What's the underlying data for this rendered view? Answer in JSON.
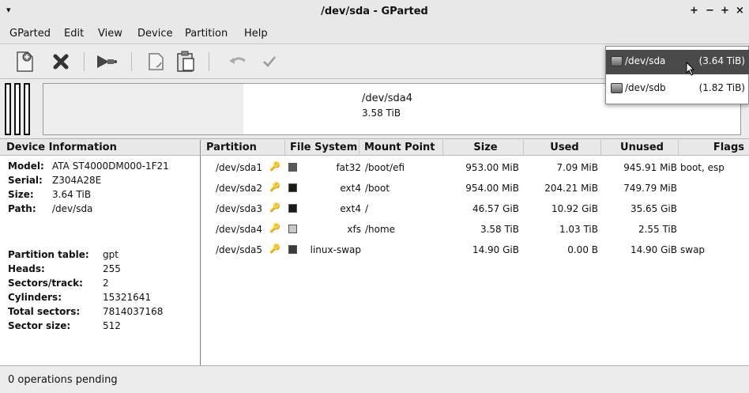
{
  "window": {
    "title": "/dev/sda - GParted",
    "menu_arrow": "▾",
    "controls": [
      "+",
      "−",
      "+",
      "×"
    ]
  },
  "menubar": [
    "GParted",
    "Edit",
    "View",
    "Device",
    "Partition",
    "Help"
  ],
  "toolbar": {
    "icons": [
      "new-partition",
      "delete",
      "resize-move",
      "copy",
      "paste",
      "undo",
      "apply"
    ]
  },
  "device_menu": {
    "items": [
      {
        "name": "/dev/sda",
        "size": "(3.64 TiB)",
        "selected": true
      },
      {
        "name": "/dev/sdb",
        "size": "(1.82 TiB)",
        "selected": false
      }
    ]
  },
  "disk_map": {
    "label": "/dev/sda4",
    "size": "3.58 TiB"
  },
  "device_info": {
    "header": "Device Information",
    "fields": [
      {
        "label": "Model:",
        "value": "ATA ST4000DM000-1F21"
      },
      {
        "label": "Serial:",
        "value": "Z304A28E"
      },
      {
        "label": "Size:",
        "value": "3.64 TiB"
      },
      {
        "label": "Path:",
        "value": "/dev/sda"
      }
    ],
    "table_fields": [
      {
        "label": "Partition table:",
        "value": "gpt"
      },
      {
        "label": "Heads:",
        "value": "255"
      },
      {
        "label": "Sectors/track:",
        "value": "2"
      },
      {
        "label": "Cylinders:",
        "value": "15321641"
      },
      {
        "label": "Total sectors:",
        "value": "7814037168"
      },
      {
        "label": "Sector size:",
        "value": "512"
      }
    ]
  },
  "partitions": {
    "columns": [
      "Partition",
      "File System",
      "Mount Point",
      "Size",
      "Used",
      "Unused",
      "Flags"
    ],
    "rows": [
      {
        "partition": "/dev/sda1",
        "color": "#5a5a5a",
        "fs": "fat32",
        "mount": "/boot/efi",
        "size": "953.00 MiB",
        "used": "7.09 MiB",
        "unused": "945.91 MiB",
        "flags": "boot, esp"
      },
      {
        "partition": "/dev/sda2",
        "color": "#1a1a1a",
        "fs": "ext4",
        "mount": "/boot",
        "size": "954.00 MiB",
        "used": "204.21 MiB",
        "unused": "749.79 MiB",
        "flags": ""
      },
      {
        "partition": "/dev/sda3",
        "color": "#1a1a1a",
        "fs": "ext4",
        "mount": "/",
        "size": "46.57 GiB",
        "used": "10.92 GiB",
        "unused": "35.65 GiB",
        "flags": ""
      },
      {
        "partition": "/dev/sda4",
        "color": "#c8c8c8",
        "fs": "xfs",
        "mount": "/home",
        "size": "3.58 TiB",
        "used": "1.03 TiB",
        "unused": "2.55 TiB",
        "flags": ""
      },
      {
        "partition": "/dev/sda5",
        "color": "#3c3c3c",
        "fs": "linux-swap",
        "mount": "",
        "size": "14.90 GiB",
        "used": "0.00 B",
        "unused": "14.90 GiB",
        "flags": "swap"
      }
    ]
  },
  "status": {
    "text": "0 operations pending"
  }
}
